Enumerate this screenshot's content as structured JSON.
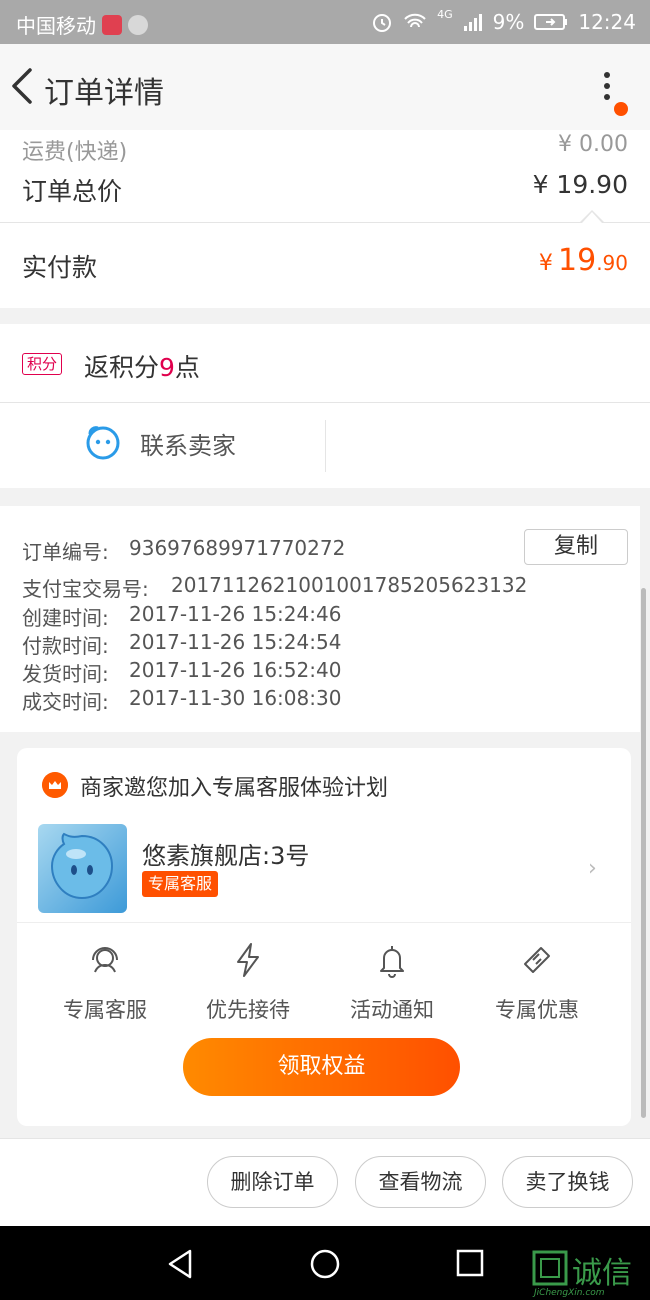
{
  "status_bar": {
    "carrier": "中国移动",
    "signal_label": "4G",
    "battery": "9%",
    "time": "12:24"
  },
  "nav": {
    "title": "订单详情"
  },
  "price": {
    "shipping_label": "运费(快递)",
    "shipping_value": "¥ 0.00",
    "total_label": "订单总价",
    "total_value": "¥ 19.90",
    "paid_label": "实付款",
    "paid_currency": "¥",
    "paid_int": "19",
    "paid_dec": ".90"
  },
  "points": {
    "badge": "积分",
    "text_prefix": "返积分",
    "points": "9",
    "text_suffix": "点"
  },
  "contact": {
    "label": "联系卖家"
  },
  "order_info": {
    "order_no_label": "订单编号:",
    "order_no": "93697689971770272",
    "copy_label": "复制",
    "alipay_label": "支付宝交易号:",
    "alipay_no": "2017112621001001785205623132",
    "created_label": "创建时间:",
    "created": "2017-11-26 15:24:46",
    "paid_label": "付款时间:",
    "paid": "2017-11-26 15:24:54",
    "shipped_label": "发货时间:",
    "shipped": "2017-11-26 16:52:40",
    "closed_label": "成交时间:",
    "closed": "2017-11-30 16:08:30"
  },
  "service": {
    "title": "商家邀您加入专属客服体验计划",
    "store_name": "悠素旗舰店:3号",
    "tag": "专属客服",
    "benefits": [
      "专属客服",
      "优先接待",
      "活动通知",
      "专属优惠"
    ],
    "claim_label": "领取权益"
  },
  "actions": {
    "delete": "删除订单",
    "logistics": "查看物流",
    "resell": "卖了换钱"
  },
  "watermark": {
    "text": "诚信",
    "sub": "JiChengXin.com"
  },
  "colors": {
    "accent": "#ff5000",
    "points": "#e0004d",
    "contact": "#2a9be8"
  }
}
